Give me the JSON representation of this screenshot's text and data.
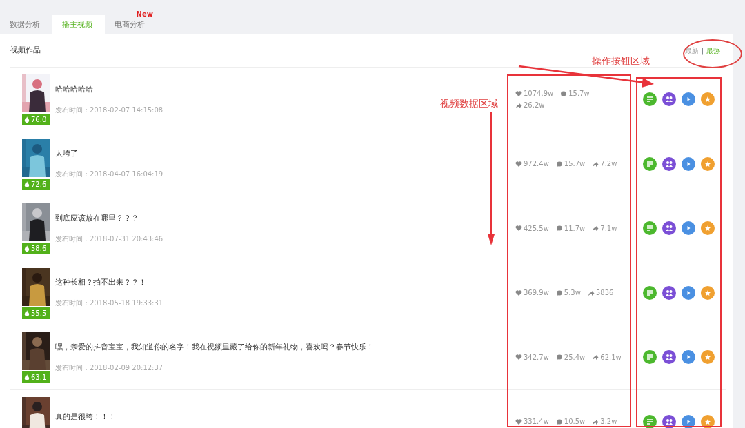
{
  "tabs": [
    {
      "label": "数据分析",
      "selected": false
    },
    {
      "label": "播主视频",
      "selected": true
    },
    {
      "label": "电商分析",
      "selected": false,
      "badge": "New"
    }
  ],
  "section_title": "视频作品",
  "sort_divider": "|",
  "sort": [
    {
      "label": "最新",
      "selected": false
    },
    {
      "label": "最热",
      "selected": true
    }
  ],
  "videos": [
    {
      "title": "哈哈哈哈哈",
      "time": "发布时间：2018-02-07 14:15:08",
      "score": "76.0",
      "likes": "1074.9w",
      "comments": "15.7w",
      "shares": "26.2w"
    },
    {
      "title": "太垮了",
      "time": "发布时间：2018-04-07 16:04:19",
      "score": "72.6",
      "likes": "972.4w",
      "comments": "15.7w",
      "shares": "7.2w"
    },
    {
      "title": "到底应该放在哪里？？？",
      "time": "发布时间：2018-07-31 20:43:46",
      "score": "58.6",
      "likes": "425.5w",
      "comments": "11.7w",
      "shares": "7.1w"
    },
    {
      "title": "这种长相？拍不出来？？！",
      "time": "发布时间：2018-05-18 19:33:31",
      "score": "55.5",
      "likes": "369.9w",
      "comments": "5.3w",
      "shares": "5836"
    },
    {
      "title": "嘿，亲爱的抖音宝宝，我知道你的名字！我在视频里藏了给你的新年礼物，喜欢吗？春节快乐！",
      "time": "发布时间：2018-02-09 20:12:37",
      "score": "63.1",
      "likes": "342.7w",
      "comments": "25.4w",
      "shares": "62.1w"
    },
    {
      "title": "真的是很垮！！！",
      "likes": "331.4w",
      "comments": "10.5w",
      "shares": "3.2w"
    }
  ],
  "annotations": [
    {
      "text": "操作按钮区域"
    },
    {
      "text": "视频数据区域"
    }
  ]
}
